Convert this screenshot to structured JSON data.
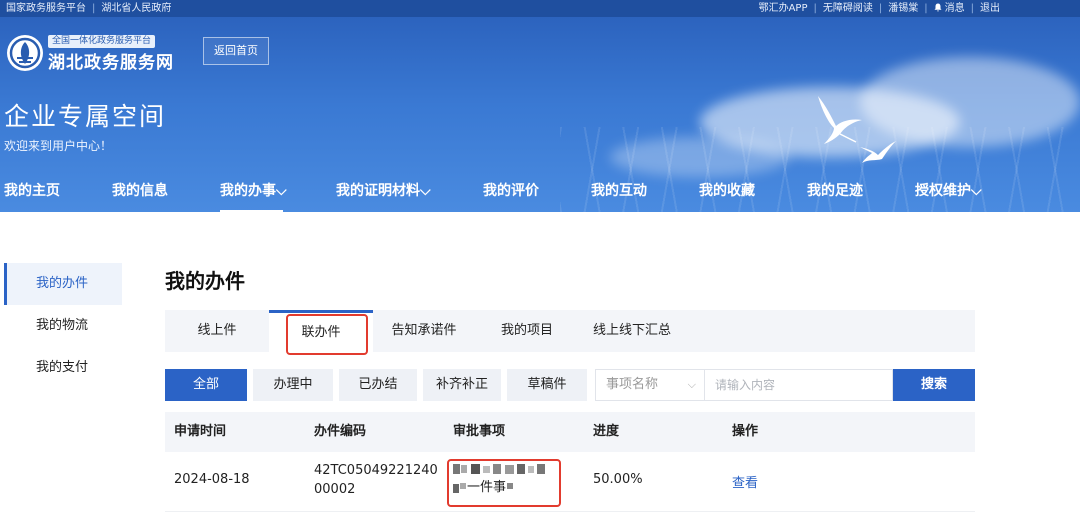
{
  "topbar": {
    "left_links": [
      "国家政务服务平台",
      "湖北省人民政府"
    ],
    "right_links": [
      "鄂汇办APP",
      "无障碍阅读",
      "潘锡棠",
      "消息",
      "退出"
    ]
  },
  "brand": {
    "tagline": "全国一体化政务服务平台",
    "name": "湖北政务服务网",
    "home_button": "返回首页"
  },
  "space": {
    "title": "企业专属空间",
    "welcome": "欢迎来到用户中心！"
  },
  "main_nav": [
    {
      "label": "我的主页",
      "dropdown": false,
      "active": false
    },
    {
      "label": "我的信息",
      "dropdown": false,
      "active": false
    },
    {
      "label": "我的办事",
      "dropdown": true,
      "active": true
    },
    {
      "label": "我的证明材料",
      "dropdown": true,
      "active": false
    },
    {
      "label": "我的评价",
      "dropdown": false,
      "active": false
    },
    {
      "label": "我的互动",
      "dropdown": false,
      "active": false
    },
    {
      "label": "我的收藏",
      "dropdown": false,
      "active": false
    },
    {
      "label": "我的足迹",
      "dropdown": false,
      "active": false
    },
    {
      "label": "授权维护",
      "dropdown": true,
      "active": false
    }
  ],
  "sidebar": {
    "items": [
      {
        "label": "我的办件",
        "active": true
      },
      {
        "label": "我的物流",
        "active": false
      },
      {
        "label": "我的支付",
        "active": false
      }
    ]
  },
  "page": {
    "title": "我的办件"
  },
  "tabs": [
    {
      "label": "线上件",
      "active": false
    },
    {
      "label": "联办件",
      "active": true
    },
    {
      "label": "告知承诺件",
      "active": false
    },
    {
      "label": "我的项目",
      "active": false
    },
    {
      "label": "线上线下汇总",
      "active": false
    }
  ],
  "filters": [
    {
      "label": "全部",
      "active": true
    },
    {
      "label": "办理中",
      "active": false
    },
    {
      "label": "已办结",
      "active": false
    },
    {
      "label": "补齐补正",
      "active": false
    },
    {
      "label": "草稿件",
      "active": false
    }
  ],
  "search": {
    "field_select": "事项名称",
    "placeholder": "请输入内容",
    "button": "搜索"
  },
  "table": {
    "columns": [
      "申请时间",
      "办件编码",
      "审批事项",
      "进度",
      "操作"
    ],
    "rows": [
      {
        "date": "2024-08-18",
        "code_line1": "42TC05049221240",
        "code_line2": "00002",
        "item_line2": "一件事",
        "progress": "50.00%",
        "action": "查看"
      }
    ]
  },
  "colors": {
    "primary": "#2b63c6",
    "banner": "#3a79d3",
    "highlight_box": "#e23b2e"
  }
}
